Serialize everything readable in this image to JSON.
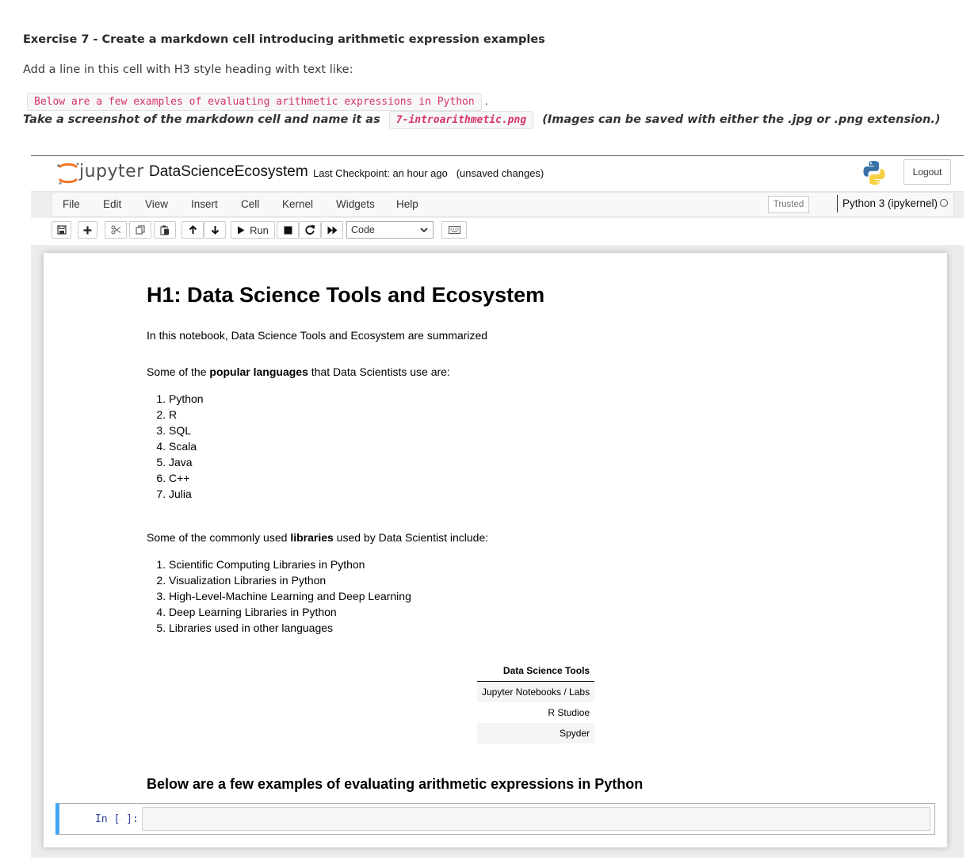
{
  "exercise": {
    "title": "Exercise 7 - Create a markdown cell introducing arithmetic expression examples",
    "subtitle": "Add a line in this cell with H3 style heading with text like:",
    "example_code": "Below are a few examples of evaluating arithmetic expressions in Python",
    "example_suffix": ".",
    "screenshot_prefix": "Take a screenshot of the markdown cell and name it as",
    "screenshot_filename": "7-introarithmetic.png",
    "screenshot_suffix": "(Images can be saved with either the .jpg or .png extension.)"
  },
  "jupyter": {
    "logo_text": "jupyter",
    "notebook_name": "DataScienceEcosystem",
    "checkpoint": "Last Checkpoint: an hour ago",
    "unsaved": "(unsaved changes)",
    "logout_label": "Logout",
    "menu": [
      "File",
      "Edit",
      "View",
      "Insert",
      "Cell",
      "Kernel",
      "Widgets",
      "Help"
    ],
    "trusted_label": "Trusted",
    "kernel_label": "Python 3 (ipykernel)",
    "toolbar": {
      "run_label": "Run",
      "cell_type": "Code",
      "icons": [
        "save-icon",
        "plus-icon",
        "cut-icon",
        "copy-icon",
        "paste-icon",
        "arrow-up-icon",
        "arrow-down-icon",
        "run-icon",
        "stop-icon",
        "restart-icon",
        "fast-forward-icon",
        "keyboard-icon"
      ]
    }
  },
  "notebook": {
    "h1": "H1: Data Science Tools and Ecosystem",
    "intro": "In this notebook, Data Science Tools and Ecosystem are summarized",
    "languages_intro": {
      "pre": "Some of the ",
      "bold": "popular languages",
      "post": " that Data Scientists use are:"
    },
    "languages": [
      "Python",
      "R",
      "SQL",
      "Scala",
      "Java",
      "C++",
      "Julia"
    ],
    "libraries_intro": {
      "pre": "Some of the commonly used ",
      "bold": "libraries",
      "post": " used by Data Scientist include:"
    },
    "libraries": [
      "Scientific Computing Libraries in Python",
      "Visualization Libraries in Python",
      "High-Level-Machine Learning and Deep Learning",
      "Deep Learning Libraries in Python",
      "Libraries used in other languages"
    ],
    "tools_table": {
      "header": "Data Science Tools",
      "rows": [
        "Jupyter Notebooks / Labs",
        "R Studioe",
        "Spyder"
      ]
    },
    "h3": "Below are a few examples of evaluating arithmetic expressions in Python",
    "code_prompt": "In [ ]:",
    "code_input": ""
  }
}
